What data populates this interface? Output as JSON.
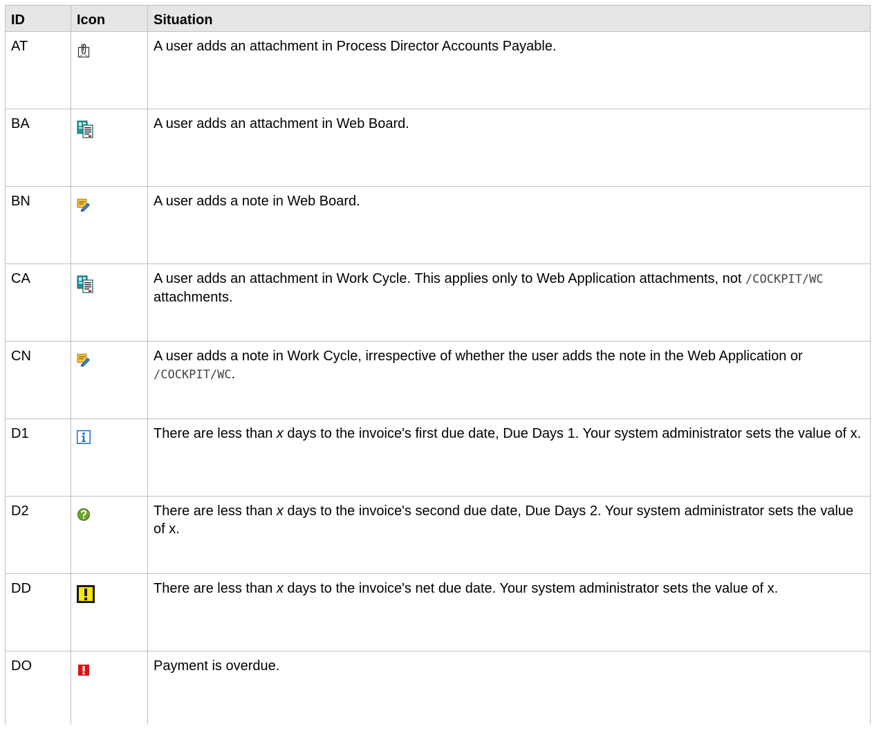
{
  "table": {
    "headers": {
      "id": "ID",
      "icon": "Icon",
      "situation": "Situation"
    },
    "rows": [
      {
        "id": "AT",
        "icon": "paperclip-attachment-icon",
        "situation": "A user adds an attachment in Process Director Accounts Payable."
      },
      {
        "id": "BA",
        "icon": "document-stack-icon",
        "situation": "A user adds an attachment in Web Board."
      },
      {
        "id": "BN",
        "icon": "note-pencil-icon",
        "situation": "A user adds a note in Web Board."
      },
      {
        "id": "CA",
        "icon": "document-stack-icon",
        "situation_parts": {
          "text1": "A user adds an attachment in Work Cycle. This applies only to Web Application attachments, not ",
          "code": "/COCKPIT/WC",
          "text2": " attachments."
        }
      },
      {
        "id": "CN",
        "icon": "note-pencil-icon",
        "situation_parts": {
          "text1": "A user adds a note in Work Cycle, irrespective of whether the user adds the note in the Web Application or ",
          "code": "/COCKPIT/WC",
          "text2": "."
        }
      },
      {
        "id": "D1",
        "icon": "info-icon",
        "situation_parts": {
          "text1": "There are less than ",
          "var": "x",
          "text2": " days to the invoice's first due date, Due Days 1. Your system administrator sets the value of x."
        }
      },
      {
        "id": "D2",
        "icon": "question-circle-icon",
        "situation_parts": {
          "text1": "There are less than ",
          "var": "x",
          "text2": " days to the invoice's second due date, Due Days 2. Your system administrator sets the value of x."
        }
      },
      {
        "id": "DD",
        "icon": "warning-exclamation-icon",
        "situation_parts": {
          "text1": "There are less than ",
          "var": "x",
          "text2": " days to the invoice's net due date. Your system administrator sets the value of x."
        }
      },
      {
        "id": "DO",
        "icon": "overdue-exclamation-icon",
        "situation": "Payment is overdue."
      }
    ]
  },
  "colors": {
    "header_bg": "#e6e6e6",
    "border": "#c0c0c0",
    "info_blue": "#1a6fc9",
    "question_green": "#6fa42a",
    "warning_yellow": "#ffe600",
    "overdue_red": "#d9141b"
  }
}
